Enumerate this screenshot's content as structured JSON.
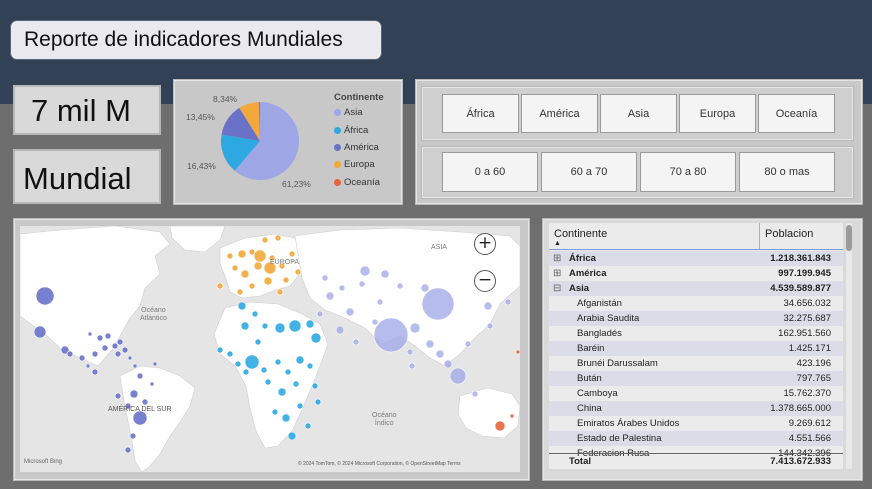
{
  "title": "Reporte de indicadores Mundiales",
  "kpi": {
    "value": "7 mil M",
    "region": "Mundial"
  },
  "colors": {
    "asia": "#9ea6e6",
    "africa": "#2ea8e0",
    "america": "#6a72c8",
    "europa": "#f2a93b",
    "oceania": "#e8643c"
  },
  "pie": {
    "legend_title": "Continente",
    "slices": [
      {
        "name": "Asia",
        "pct": 61.23,
        "label": "61,23%"
      },
      {
        "name": "África",
        "pct": 16.43,
        "label": "16,43%"
      },
      {
        "name": "América",
        "pct": 13.45,
        "label": "13,45%"
      },
      {
        "name": "Europa",
        "pct": 8.34,
        "label": "8,34%"
      },
      {
        "name": "Oceanía",
        "pct": 0.55,
        "label": ""
      }
    ]
  },
  "slicer_continents": [
    "África",
    "América",
    "Asia",
    "Europa",
    "Oceanía"
  ],
  "slicer_ages": [
    "0 a 60",
    "60 a 70",
    "70 a 80",
    "80 o mas"
  ],
  "map": {
    "labels": {
      "europa": "EUROPA",
      "asia": "ASIA",
      "atlantico": "Océano\nAtlántico",
      "america_sur": "AMÉRICA DEL SUR",
      "indico": "Océano\nÍndico"
    },
    "zoom_in": "+",
    "zoom_out": "−",
    "brand": "Microsoft Bing",
    "copyright": "© 2024 TomTom, © 2024 Microsoft Corporation, © OpenStreetMap  Terms"
  },
  "table": {
    "col1": "Continente",
    "col2": "Poblacion",
    "rows": [
      {
        "name": "África",
        "value": "1.218.361.843",
        "group": true,
        "expanded": false
      },
      {
        "name": "América",
        "value": "997.199.945",
        "group": true,
        "expanded": false
      },
      {
        "name": "Asia",
        "value": "4.539.589.877",
        "group": true,
        "expanded": true
      },
      {
        "name": "Afganistán",
        "value": "34.656.032"
      },
      {
        "name": "Arabia Saudita",
        "value": "32.275.687"
      },
      {
        "name": "Bangladés",
        "value": "162.951.560"
      },
      {
        "name": "Baréin",
        "value": "1.425.171"
      },
      {
        "name": "Brunéi Darussalam",
        "value": "423.196"
      },
      {
        "name": "Bután",
        "value": "797.765"
      },
      {
        "name": "Camboya",
        "value": "15.762.370"
      },
      {
        "name": "China",
        "value": "1.378.665.000"
      },
      {
        "name": "Emiratos Árabes Unidos",
        "value": "9.269.612"
      },
      {
        "name": "Estado de Palestina",
        "value": "4.551.566"
      },
      {
        "name": "Federacion Rusa",
        "value": "144.342.396"
      }
    ],
    "total_label": "Total",
    "total_value": "7.413.672.933"
  }
}
